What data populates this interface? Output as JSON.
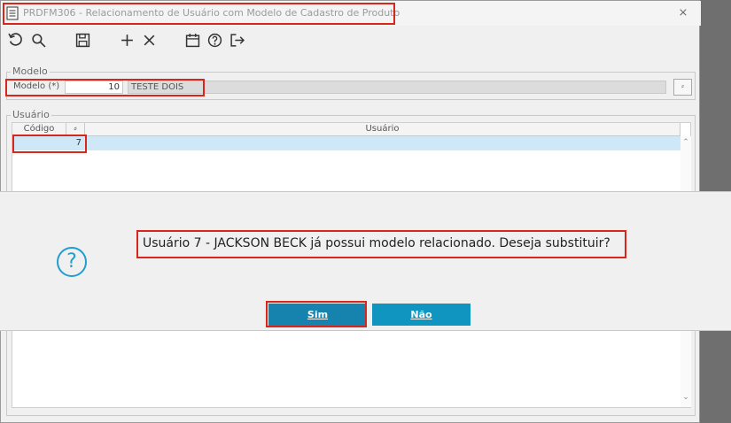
{
  "window": {
    "title": "PRDFM306 - Relacionamento de Usuário com Modelo de Cadastro de Produto",
    "close_glyph": "⨯"
  },
  "toolbar": {
    "buttons": [
      {
        "icon": "refresh-icon"
      },
      {
        "icon": "search-icon"
      },
      {
        "icon": "save-icon"
      },
      {
        "icon": "add-icon",
        "glyph": "+"
      },
      {
        "icon": "close-icon",
        "glyph": "✕"
      },
      {
        "icon": "calendar-icon"
      },
      {
        "icon": "help-icon"
      },
      {
        "icon": "exit-icon"
      }
    ]
  },
  "modelo": {
    "legend": "Modelo",
    "label": "Modelo (*)",
    "code": "10",
    "description": "TESTE DOIS",
    "lookup_glyph": "⸗"
  },
  "usuario": {
    "legend": "Usuário",
    "columns": {
      "codigo": "Código",
      "flag": "⸗",
      "usuario": "Usuário"
    },
    "rows": [
      {
        "codigo": "7",
        "usuario": ""
      }
    ],
    "scroll_up": "⌃",
    "scroll_down": "⌄"
  },
  "dialog": {
    "icon_glyph": "?",
    "message": "Usuário 7 - JACKSON BECK já possui modelo relacionado. Deseja substituir?",
    "yes_label": "Sim",
    "no_label": "Não"
  },
  "colors": {
    "accent": "#0f95c0",
    "highlight_border": "#d9261c",
    "selected_row": "#cfe8f7"
  }
}
